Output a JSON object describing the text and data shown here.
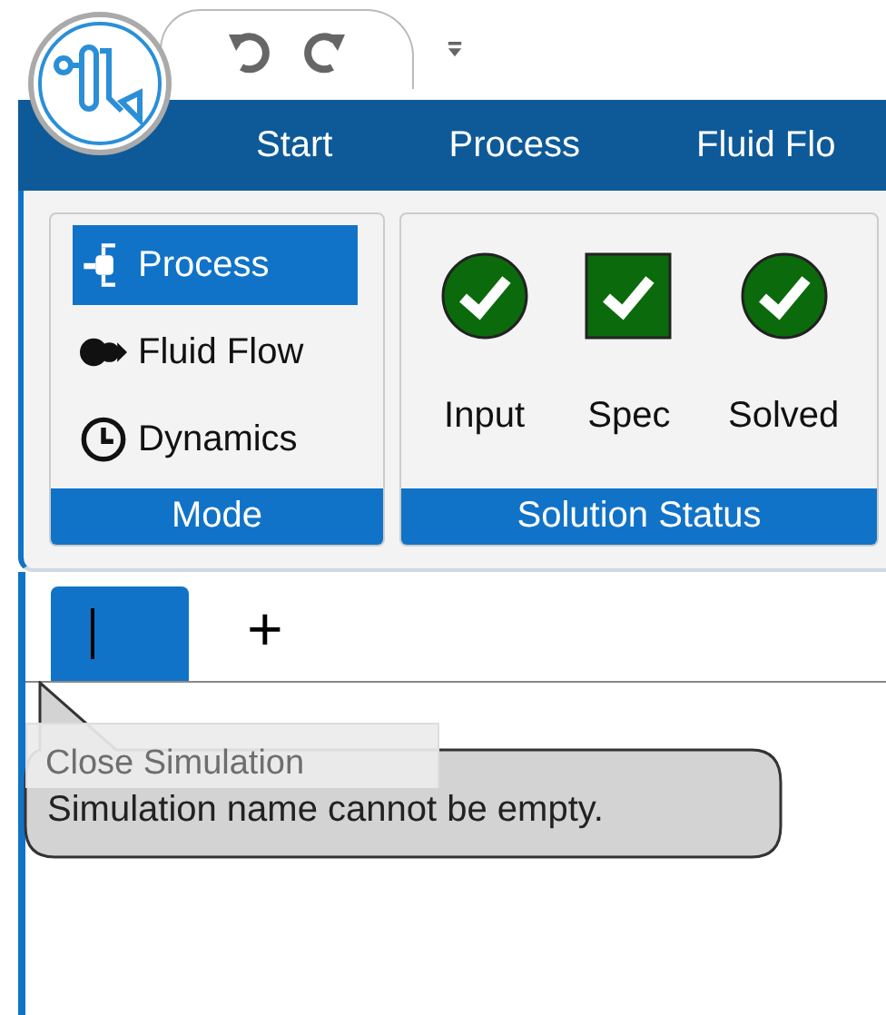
{
  "ribbon_tabs": [
    {
      "label": "Start",
      "selected": false
    },
    {
      "label": "Process",
      "selected": false
    },
    {
      "label": "Fluid Flo",
      "selected": false
    }
  ],
  "mode_group": {
    "title": "Mode",
    "items": [
      {
        "label": "Process",
        "selected": true
      },
      {
        "label": "Fluid Flow",
        "selected": false
      },
      {
        "label": "Dynamics",
        "selected": false
      }
    ]
  },
  "status_group": {
    "title": "Solution Status",
    "items": [
      {
        "label": "Input",
        "kind": "circle",
        "ok": true
      },
      {
        "label": "Spec",
        "kind": "square",
        "ok": true
      },
      {
        "label": "Solved",
        "kind": "circle",
        "ok": true
      }
    ]
  },
  "simulation_tabs": [
    {
      "selected": true
    }
  ],
  "add_tab": "+",
  "close_button": {
    "label": "Close Simulation",
    "disabled": true
  },
  "tooltip": "Simulation name cannot be empty."
}
